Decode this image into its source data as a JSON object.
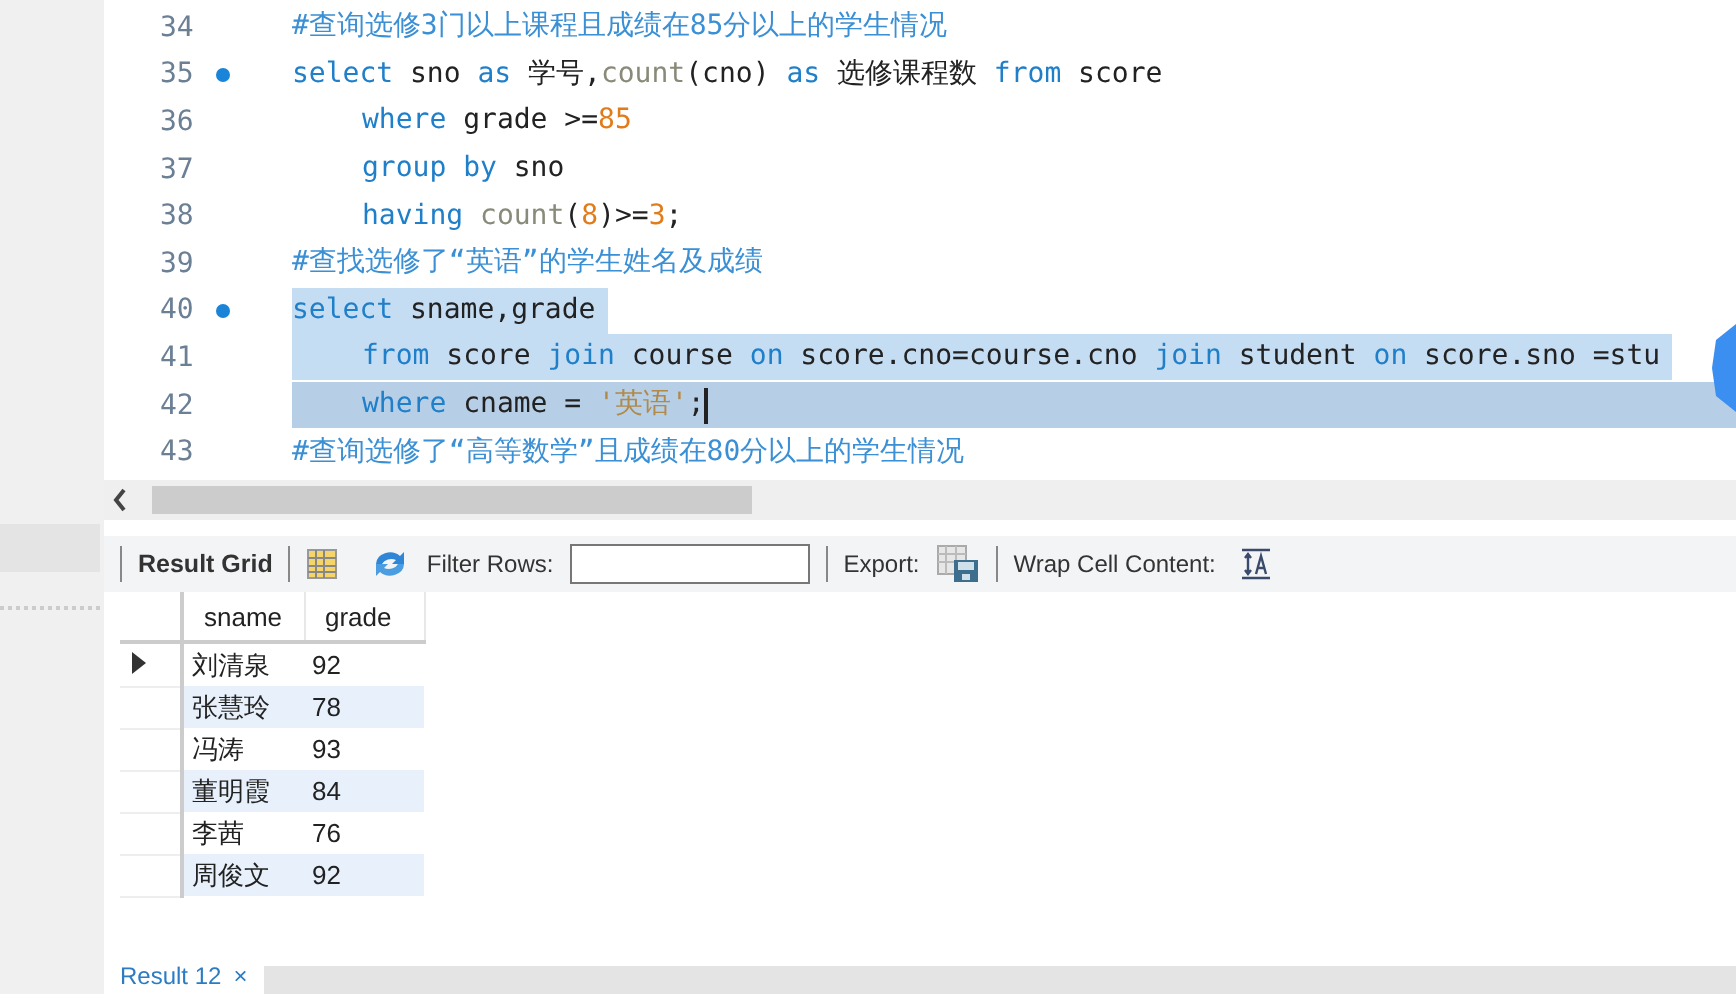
{
  "editor": {
    "lines": [
      {
        "number": "34",
        "breakpoint": false,
        "indent": false,
        "selected": false,
        "current": false,
        "cursor": false,
        "tokens": [
          {
            "kind": "comment",
            "text": "#查询选修3门以上课程且成绩在85分以上的学生情况"
          }
        ]
      },
      {
        "number": "35",
        "breakpoint": true,
        "indent": false,
        "selected": false,
        "current": false,
        "cursor": false,
        "tokens": [
          {
            "kind": "keyword",
            "text": "select"
          },
          {
            "kind": "plain",
            "text": " sno "
          },
          {
            "kind": "keyword",
            "text": "as"
          },
          {
            "kind": "plain",
            "text": " 学号,"
          },
          {
            "kind": "func",
            "text": "count"
          },
          {
            "kind": "plain",
            "text": "(cno) "
          },
          {
            "kind": "keyword",
            "text": "as"
          },
          {
            "kind": "plain",
            "text": " 选修课程数 "
          },
          {
            "kind": "keyword",
            "text": "from"
          },
          {
            "kind": "plain",
            "text": " score"
          }
        ]
      },
      {
        "number": "36",
        "breakpoint": false,
        "indent": true,
        "selected": false,
        "current": false,
        "cursor": false,
        "tokens": [
          {
            "kind": "keyword",
            "text": "where"
          },
          {
            "kind": "plain",
            "text": " grade >="
          },
          {
            "kind": "number",
            "text": "85"
          }
        ]
      },
      {
        "number": "37",
        "breakpoint": false,
        "indent": true,
        "selected": false,
        "current": false,
        "cursor": false,
        "tokens": [
          {
            "kind": "keyword",
            "text": "group by"
          },
          {
            "kind": "plain",
            "text": " sno"
          }
        ]
      },
      {
        "number": "38",
        "breakpoint": false,
        "indent": true,
        "selected": false,
        "current": false,
        "cursor": false,
        "tokens": [
          {
            "kind": "keyword",
            "text": "having "
          },
          {
            "kind": "func",
            "text": "count"
          },
          {
            "kind": "plain",
            "text": "("
          },
          {
            "kind": "number",
            "text": "8"
          },
          {
            "kind": "plain",
            "text": ")>="
          },
          {
            "kind": "number",
            "text": "3"
          },
          {
            "kind": "plain",
            "text": ";"
          }
        ]
      },
      {
        "number": "39",
        "breakpoint": false,
        "indent": false,
        "selected": false,
        "current": false,
        "cursor": false,
        "tokens": [
          {
            "kind": "comment",
            "text": "#查找选修了“英语”的学生姓名及成绩"
          }
        ]
      },
      {
        "number": "40",
        "breakpoint": true,
        "indent": false,
        "selected": true,
        "current": false,
        "cursor": false,
        "tokens": [
          {
            "kind": "keyword",
            "text": "select"
          },
          {
            "kind": "plain",
            "text": " sname,grade"
          }
        ]
      },
      {
        "number": "41",
        "breakpoint": false,
        "indent": true,
        "selected": true,
        "current": false,
        "cursor": false,
        "tokens": [
          {
            "kind": "keyword",
            "text": "from"
          },
          {
            "kind": "plain",
            "text": " score "
          },
          {
            "kind": "keyword",
            "text": "join"
          },
          {
            "kind": "plain",
            "text": " course "
          },
          {
            "kind": "keyword",
            "text": "on"
          },
          {
            "kind": "plain",
            "text": " score.cno=course.cno "
          },
          {
            "kind": "keyword",
            "text": "join"
          },
          {
            "kind": "plain",
            "text": " student "
          },
          {
            "kind": "keyword",
            "text": "on"
          },
          {
            "kind": "plain",
            "text": " score.sno =stu"
          }
        ]
      },
      {
        "number": "42",
        "breakpoint": false,
        "indent": true,
        "selected": false,
        "current": true,
        "cursor": true,
        "tokens": [
          {
            "kind": "keyword",
            "text": "where"
          },
          {
            "kind": "plain",
            "text": " cname = "
          },
          {
            "kind": "string",
            "text": "'英语'"
          },
          {
            "kind": "plain",
            "text": ";"
          }
        ]
      },
      {
        "number": "43",
        "breakpoint": false,
        "indent": false,
        "selected": false,
        "current": false,
        "cursor": false,
        "tokens": [
          {
            "kind": "comment",
            "text": "#查询选修了“高等数学”且成绩在80分以上的学生情况"
          }
        ]
      }
    ]
  },
  "toolbar": {
    "result_grid": "Result Grid",
    "filter_label": "Filter Rows:",
    "export_label": "Export:",
    "wrap_label": "Wrap Cell Content:"
  },
  "table": {
    "columns": [
      "sname",
      "grade"
    ],
    "rows": [
      {
        "selected": true,
        "cells": [
          "刘清泉",
          "92"
        ]
      },
      {
        "selected": false,
        "cells": [
          "张慧玲",
          "78"
        ]
      },
      {
        "selected": false,
        "cells": [
          "冯涛",
          "93"
        ]
      },
      {
        "selected": false,
        "cells": [
          "董明霞",
          "84"
        ]
      },
      {
        "selected": false,
        "cells": [
          "李茜",
          "76"
        ]
      },
      {
        "selected": false,
        "cells": [
          "周俊文",
          "92"
        ]
      }
    ]
  },
  "result_tab": {
    "label": "Result 12",
    "close": "×"
  }
}
